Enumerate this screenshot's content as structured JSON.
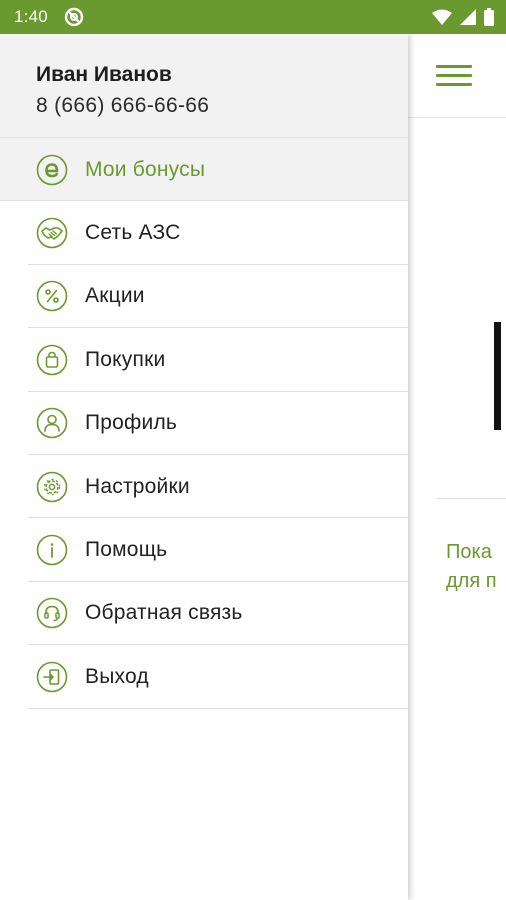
{
  "status_bar": {
    "time": "1:40",
    "bg_color": "#6a9a2f",
    "icons": [
      "sync-icon",
      "wifi-icon",
      "signal-icon",
      "battery-icon"
    ]
  },
  "drawer": {
    "user": {
      "name": "Иван Иванов",
      "phone": "8 (666) 666-66-66"
    },
    "items": [
      {
        "label": "Мои бонусы",
        "icon": "bonus-e-icon",
        "active": true
      },
      {
        "label": "Сеть АЗС",
        "icon": "handshake-icon"
      },
      {
        "label": "Акции",
        "icon": "percent-icon"
      },
      {
        "label": "Покупки",
        "icon": "shopping-bag-icon"
      },
      {
        "label": "Профиль",
        "icon": "person-icon"
      },
      {
        "label": "Настройки",
        "icon": "gear-icon"
      },
      {
        "label": "Помощь",
        "icon": "info-icon"
      },
      {
        "label": "Обратная связь",
        "icon": "headset-icon"
      },
      {
        "label": "Выход",
        "icon": "logout-icon"
      }
    ]
  },
  "background": {
    "menu_icon": "hamburger-icon",
    "hint_line1": "Пока",
    "hint_line2": "для п"
  },
  "colors": {
    "accent": "#6a9a2f",
    "header_bg": "#f2f2f2",
    "text": "#222222"
  }
}
